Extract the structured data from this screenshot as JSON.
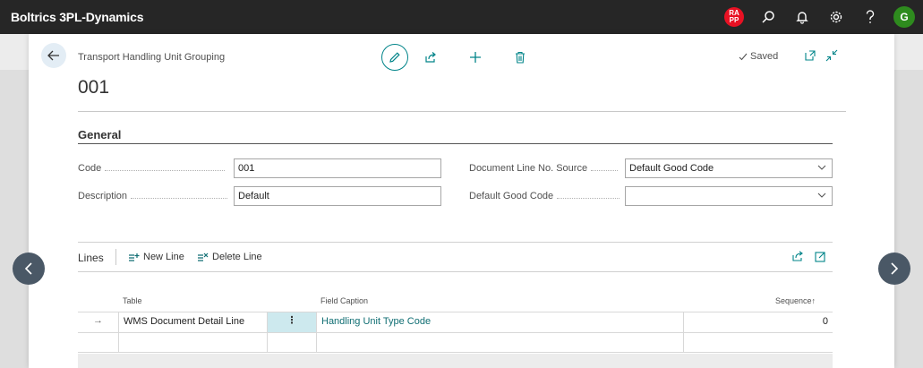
{
  "app": {
    "title": "Boltrics 3PL-Dynamics",
    "badge": "RA\nPP",
    "badge_top": "RA",
    "badge_bottom": "PP",
    "avatar_initial": "G"
  },
  "page": {
    "breadcrumb": "Transport Handling Unit Grouping",
    "title": "001",
    "saved_label": "Saved"
  },
  "general": {
    "heading": "General",
    "code_label": "Code",
    "code_value": "001",
    "description_label": "Description",
    "description_value": "Default",
    "doc_line_source_label": "Document Line No. Source",
    "doc_line_source_value": "Default Good Code",
    "default_good_code_label": "Default Good Code",
    "default_good_code_value": ""
  },
  "lines": {
    "heading": "Lines",
    "new_line": "New Line",
    "delete_line": "Delete Line",
    "columns": {
      "table": "Table",
      "field_caption": "Field Caption",
      "sequence": "Sequence"
    },
    "rows": [
      {
        "table": "WMS Document Detail Line",
        "field_caption": "Handling Unit Type Code",
        "sequence": "0"
      },
      {
        "table": "",
        "field_caption": "",
        "sequence": ""
      }
    ]
  },
  "colors": {
    "accent": "#008489",
    "appbar": "#262626",
    "link": "#106e73",
    "nav": "#4a5866"
  }
}
